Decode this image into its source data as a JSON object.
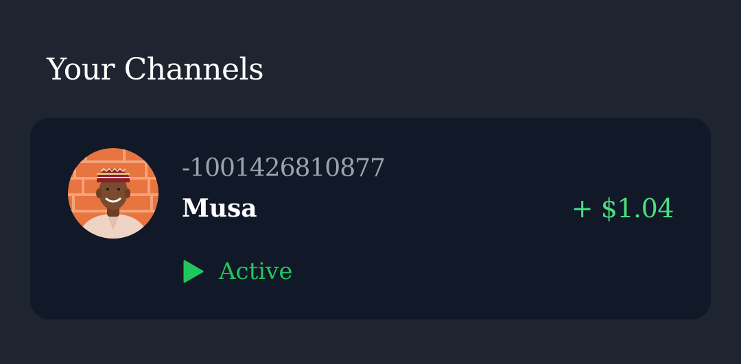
{
  "section": {
    "title": "Your Channels"
  },
  "channels": [
    {
      "id": "-1001426810877",
      "name": "Musa",
      "earnings": "+ $1.04",
      "status": "Active",
      "status_icon": "play-icon",
      "avatar_icon": "user-photo"
    }
  ],
  "colors": {
    "background": "#1e2530",
    "card": "#111827",
    "accent_green": "#4ade80",
    "status_green": "#22c55e",
    "muted_text": "#9ca3af"
  }
}
